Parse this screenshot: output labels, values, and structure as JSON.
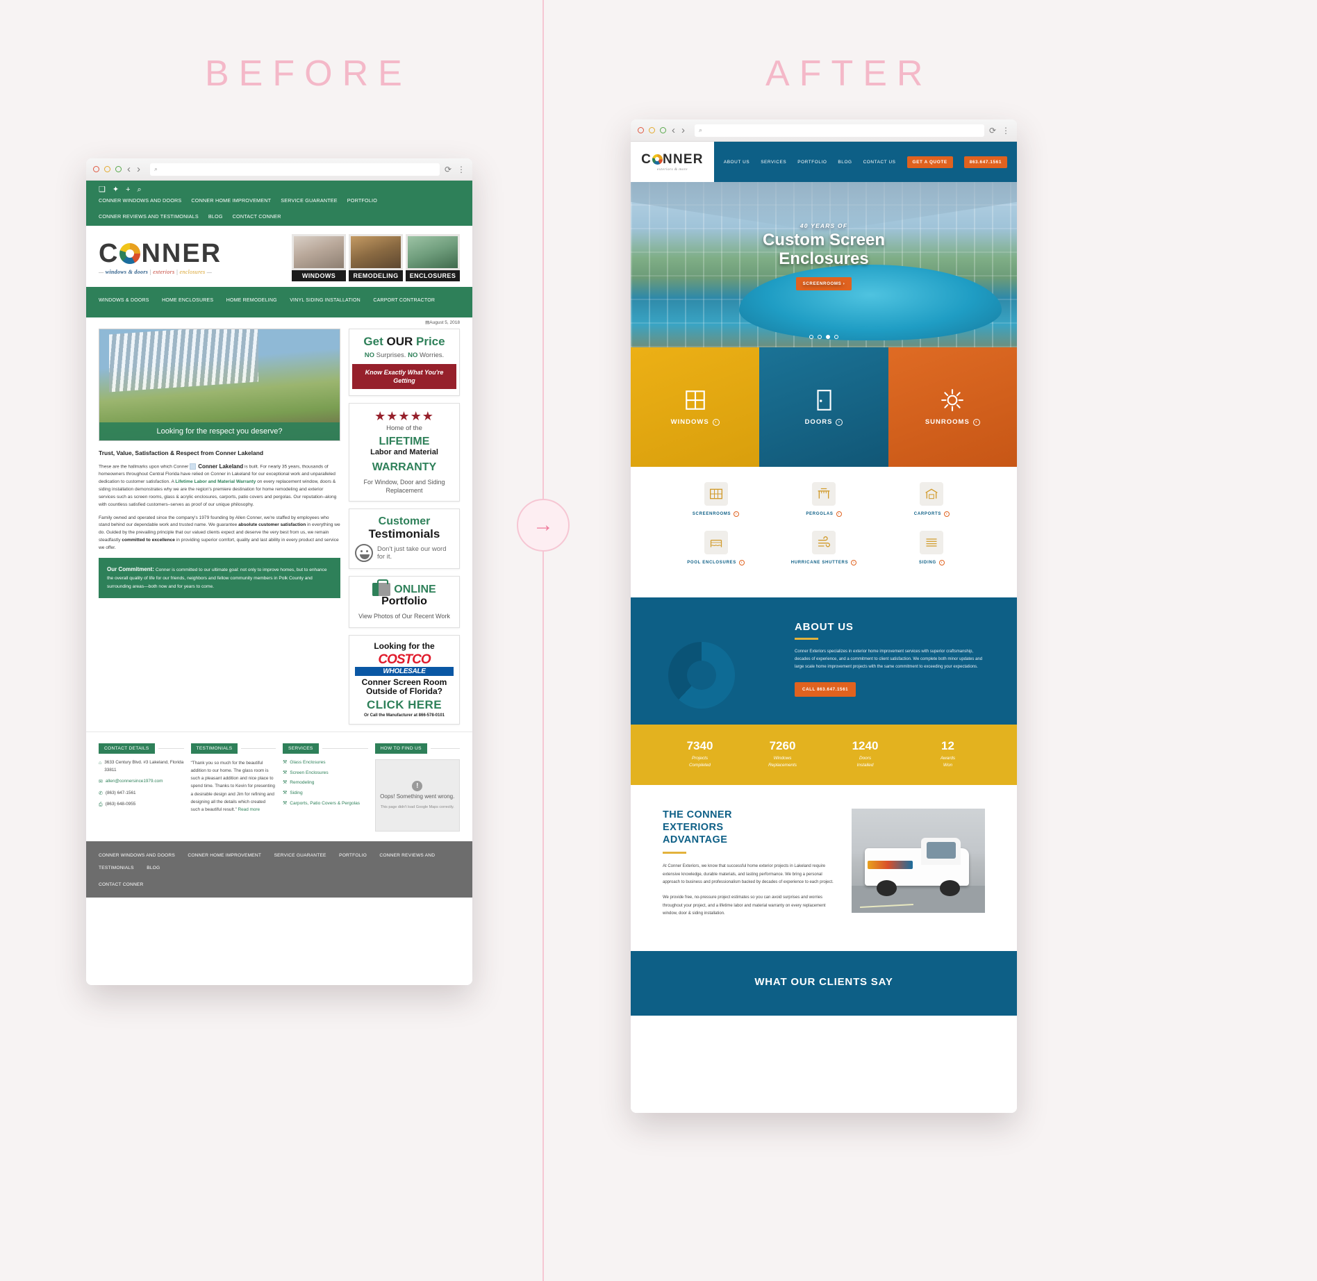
{
  "labels": {
    "before": "BEFORE",
    "after": "AFTER",
    "arrow_icon": "arrow-right-icon"
  },
  "browser": {
    "dots": [
      "red",
      "yellow",
      "green"
    ],
    "back_icon": "chevron-left-icon",
    "forward_icon": "chevron-right-icon",
    "search_icon": "search-icon",
    "url_value": "",
    "url_placeholder": "",
    "reload_icon": "reload-icon",
    "menu_icon": "kebab-menu-icon"
  },
  "before": {
    "topbar": {
      "social": [
        "facebook-icon",
        "twitter-icon",
        "plus-icon",
        "search-icon"
      ],
      "menu": [
        "CONNER WINDOWS AND DOORS",
        "CONNER HOME IMPROVEMENT",
        "SERVICE GUARANTEE",
        "PORTFOLIO",
        "CONNER REVIEWS AND TESTIMONIALS",
        "BLOG",
        "CONTACT CONNER"
      ]
    },
    "logo": {
      "word_left": "C",
      "word_right": "NNER",
      "tagline_1": "windows & doors",
      "tagline_2": "exteriors",
      "tagline_3": "enclosures",
      "dash": "—"
    },
    "tiles": [
      {
        "label": "WINDOWS"
      },
      {
        "label": "REMODELING"
      },
      {
        "label": "ENCLOSURES"
      }
    ],
    "nav2": [
      "WINDOWS & DOORS",
      "HOME ENCLOSURES",
      "HOME REMODELING",
      "VINYL SIDING INSTALLATION",
      "CARPORT CONTRACTOR"
    ],
    "date": "August 5, 2018",
    "date_icon": "calendar-icon",
    "hero_caption": "Looking for the respect you deserve?",
    "heading": "Trust, Value, Satisfaction & Respect from Conner Lakeland",
    "broken_image_caption": "Conner Lakeland",
    "para1_a": "These are the hallmarks upon which Conner",
    "para1_b": "is built. For nearly 35 years, thousands of homeowners throughout Central Florida have relied on Conner in Lakeland for our exceptional work and unparalleled dedication to customer satisfaction. A ",
    "para1_link": "Lifetime Labor and Material Warranty",
    "para1_c": " on every replacement window, doors & siding installation demonstrates why we are the region's premiere destination for home remodeling and exterior services such as screen rooms, glass & acrylic enclosures, carports, patio covers and pergolas. Our reputation–along with countless satisfied customers–serves as proof of our unique philosophy.",
    "para2_a": "Family owned and operated since the company's 1979 founding by Allen Conner, we're staffed by employees who stand behind our dependable work and trusted name. We guarantee ",
    "para2_b1": "absolute customer satisfaction",
    "para2_c": " in everything we do. Guided by the prevailing principle that our valued clients expect and deserve the very best from us, we remain steadfastly ",
    "para2_b2": "committed to excellence",
    "para2_d": " in providing superior comfort, quality and last ability in every product and service we offer.",
    "commitment_label": "Our Commitment:",
    "commitment_text": " Conner is committed to our ultimate goal: not only to improve homes, but to enhance the overall quality of life for our friends, neighbors and fellow community members in Polk County and surrounding areas—both now and for years to come.",
    "widgets": {
      "price": {
        "line1_a": "Get ",
        "line1_b": "OUR",
        "line1_c": " Price",
        "line2_a": "NO",
        "line2_b": " Surprises. ",
        "line2_c": "NO",
        "line2_d": " Worries.",
        "ribbon": "Know Exactly What You're Getting"
      },
      "warranty": {
        "stars": "★★★★★",
        "home_of": "Home of the",
        "lifetime": "LIFETIME",
        "labor": "Labor and Material",
        "warranty": "WARRANTY",
        "footer": "For Window, Door and Siding Replacement"
      },
      "testimonials": {
        "line1": "Customer",
        "line2": "Testimonials",
        "smiley_icon": "smiley-face-icon",
        "line3": "Don't just take our word for it."
      },
      "portfolio": {
        "icon": "briefcase-icon",
        "line1": "ONLINE",
        "line2": "Portfolio",
        "line3": "View Photos of Our Recent Work"
      },
      "costco": {
        "line1": "Looking for the",
        "brand": "COSTCO",
        "brand_sub": "WHOLESALE",
        "line2": "Conner Screen Room Outside of Florida?",
        "cta": "CLICK HERE",
        "fine": "Or Call the Manufacturer at 866-578-0101"
      }
    },
    "footer_widgets": {
      "contact": {
        "title": "CONTACT DETAILS",
        "address_icon": "home-icon",
        "address": "3633 Century Blvd. #3 Lakeland, Florida 33811",
        "email_icon": "envelope-icon",
        "email": "allen@connersince1979.com",
        "phone_icon": "phone-icon",
        "phone": "(863) 647-1561",
        "fax_icon": "fax-icon",
        "fax": "(863) 648-0955"
      },
      "testimonials": {
        "title": "TESTIMONIALS",
        "quote": "\"Thank you so much for the beautiful addition to our home. The glass room is such a pleasant addition and nice place to spend time. Thanks to Kevin for presenting a desirable design and Jim for refining and designing all the details which created such a beautiful result.\"",
        "read_more": "Read more"
      },
      "services": {
        "title": "SERVICES",
        "bullet_icon": "hammer-icon",
        "items": [
          "Glass Enclosures",
          "Screen Enclosures",
          "Remodeling",
          "Siding",
          "Carports, Patio Covers & Pergolas"
        ]
      },
      "map": {
        "title": "HOW TO FIND US",
        "error_icon": "exclamation-icon",
        "error_title": "Oops! Something went wrong.",
        "error_sub": "This page didn't load Google Maps correctly."
      }
    },
    "footer_menu": [
      "CONNER WINDOWS AND DOORS",
      "CONNER HOME IMPROVEMENT",
      "SERVICE GUARANTEE",
      "PORTFOLIO",
      "CONNER REVIEWS AND TESTIMONIALS",
      "BLOG",
      "CONTACT CONNER"
    ]
  },
  "after": {
    "logo": {
      "word_left": "C",
      "word_right": "NNER",
      "tagline": "exteriors & more"
    },
    "nav": [
      "ABOUT US",
      "SERVICES",
      "PORTFOLIO",
      "BLOG",
      "CONTACT US"
    ],
    "cta_quote": "GET A QUOTE",
    "cta_phone": "863.647.1561",
    "hero": {
      "eyebrow": "40 YEARS OF",
      "title_1": "Custom Screen",
      "title_2": "Enclosures",
      "button": "SCREENROOMS ›",
      "slide_count": 4,
      "active_slide": 3
    },
    "trio": [
      {
        "label": "WINDOWS",
        "icon": "window-grid-icon"
      },
      {
        "label": "DOORS",
        "icon": "door-icon"
      },
      {
        "label": "SUNROOMS",
        "icon": "sun-icon"
      }
    ],
    "services": [
      {
        "label": "SCREENROOMS",
        "icon": "screen-grid-icon"
      },
      {
        "label": "PERGOLAS",
        "icon": "pergola-icon"
      },
      {
        "label": "CARPORTS",
        "icon": "carport-icon"
      },
      {
        "label": "POOL ENCLOSURES",
        "icon": "pool-enclosure-icon"
      },
      {
        "label": "HURRICANE SHUTTERS",
        "icon": "wind-icon"
      },
      {
        "label": "SIDING",
        "icon": "siding-icon"
      }
    ],
    "about": {
      "title": "ABOUT US",
      "body": "Conner Exteriors specializes in exterior home improvement services with superior craftsmanship, decades of experience, and a commitment to client satisfaction. We complete both minor updates and large scale home improvement projects with the same commitment to exceeding your expectations.",
      "button": "CALL 863.647.1561"
    },
    "stats": [
      {
        "number": "7340",
        "label_1": "Projects",
        "label_2": "Completed"
      },
      {
        "number": "7260",
        "label_1": "Windows",
        "label_2": "Replacements"
      },
      {
        "number": "1240",
        "label_1": "Doors",
        "label_2": "Installed"
      },
      {
        "number": "12",
        "label_1": "Awards",
        "label_2": "Won"
      }
    ],
    "advantage": {
      "title_1": "THE CONNER",
      "title_2": "EXTERIORS",
      "title_3": "ADVANTAGE",
      "para1": "At Conner Exteriors, we know that successful home exterior projects in Lakeland require extensive knowledge, durable materials, and lasting performance. We bring a personal approach to business and professionalism backed by decades of experience to each project.",
      "para2": "We provide free, no-pressure project estimates so you can avoid surprises and worries throughout your project, and a lifetime labor and material warranty on every replacement window, door & siding installation."
    },
    "clients_title": "WHAT OUR CLIENTS SAY"
  },
  "colors": {
    "pink": "#f4b8c8",
    "before_green": "#2e8059",
    "after_blue": "#0d5f86",
    "after_orange": "#e0621f",
    "after_yellow": "#e3b21f"
  }
}
